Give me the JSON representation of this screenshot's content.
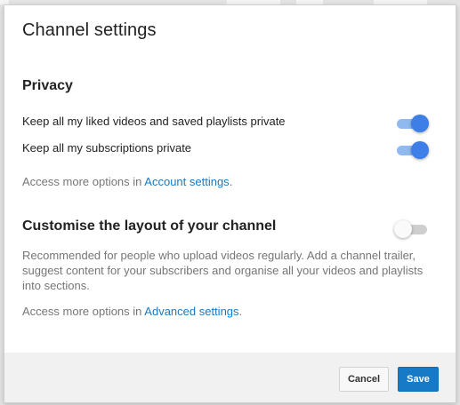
{
  "dialog": {
    "title": "Channel settings"
  },
  "privacy": {
    "heading": "Privacy",
    "options": [
      {
        "label": "Keep all my liked videos and saved playlists private",
        "enabled": true
      },
      {
        "label": "Keep all my subscriptions private",
        "enabled": true
      }
    ],
    "note_prefix": "Access more options in ",
    "note_link": "Account settings",
    "note_suffix": "."
  },
  "layout": {
    "heading": "Customise the layout of your channel",
    "enabled": false,
    "description": "Recommended for people who upload videos regularly. Add a channel trailer, suggest content for your subscribers and organise all your videos and playlists into sections.",
    "note_prefix": "Access more options in ",
    "note_link": "Advanced settings",
    "note_suffix": "."
  },
  "footer": {
    "cancel_label": "Cancel",
    "save_label": "Save"
  },
  "colors": {
    "accent": "#167ac6",
    "toggle_on": "#3d7fe6",
    "toggle_on_track": "#8fb9ef",
    "toggle_off_track": "#cfcfcf"
  }
}
